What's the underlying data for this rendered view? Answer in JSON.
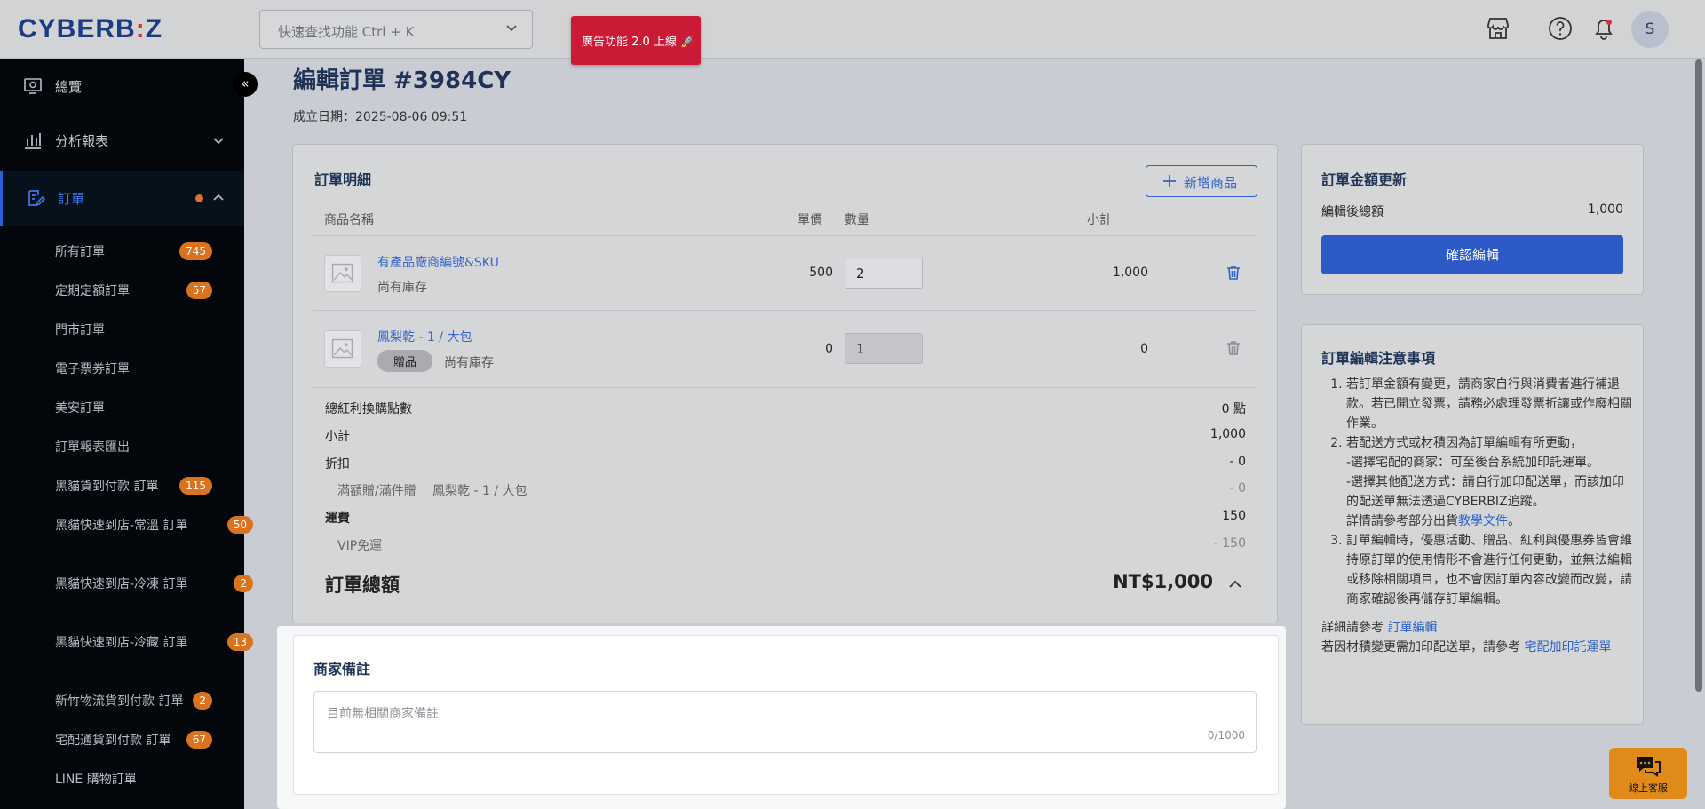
{
  "header": {
    "logo": "CYBERB",
    "logo_dot": ":",
    "logo_end": "Z",
    "search_placeholder": "快速查找功能 Ctrl + K",
    "promo": "廣告功能 2.0 上線 🚀",
    "avatar_initial": "S"
  },
  "sidebar": {
    "overview": "總覽",
    "reports": "分析報表",
    "orders": "訂單",
    "sub_items": [
      {
        "label": "所有訂單",
        "badge": "745"
      },
      {
        "label": "定期定額訂單",
        "badge": "57"
      },
      {
        "label": "門市訂單",
        "badge": ""
      },
      {
        "label": "電子票券訂單",
        "badge": ""
      },
      {
        "label": "美安訂單",
        "badge": ""
      },
      {
        "label": "訂單報表匯出",
        "badge": ""
      },
      {
        "label": "黑貓貨到付款 訂單",
        "badge": "115"
      },
      {
        "label": "黑貓快速到店-常溫 訂單",
        "badge": "50"
      },
      {
        "label": "黑貓快速到店-冷凍 訂單",
        "badge": "2"
      },
      {
        "label": "黑貓快速到店-冷藏 訂單",
        "badge": "13"
      },
      {
        "label": "新竹物流貨到付款 訂單",
        "badge": "2"
      },
      {
        "label": "宅配通貨到付款 訂單",
        "badge": "67"
      },
      {
        "label": "LINE 購物訂單",
        "badge": ""
      }
    ]
  },
  "page": {
    "title": "編輯訂單 #3984CY",
    "created": "成立日期：2025-08-06 09:51"
  },
  "order_detail": {
    "title": "訂單明細",
    "add_button": "新增商品",
    "columns": {
      "name": "商品名稱",
      "price": "單價",
      "qty": "數量",
      "subtotal": "小計"
    },
    "items": [
      {
        "name": "有產品廠商編號&SKU",
        "tag": "",
        "stock": "尚有庫存",
        "price": "500",
        "qty": "2",
        "subtotal": "1,000"
      },
      {
        "name": "鳳梨乾 - 1 / 大包",
        "tag": "贈品",
        "stock": "尚有庫存",
        "price": "0",
        "qty": "1",
        "subtotal": "0"
      }
    ],
    "summary": {
      "points_label": "總紅利換購點數",
      "points_value": "0 點",
      "subtotal_label": "小計",
      "subtotal_value": "1,000",
      "discount_label": "折扣",
      "discount_value": "- 0",
      "discount_sub_label": "滿額贈/滿件贈",
      "discount_sub_item": "鳳梨乾 - 1 / 大包",
      "discount_sub_value": "- 0",
      "shipping_label": "運費",
      "shipping_value": "150",
      "shipping_sub_label": "VIP免運",
      "shipping_sub_value": "- 150",
      "total_label": "訂單總額",
      "total_value": "NT$1,000"
    }
  },
  "merchant_note": {
    "title": "商家備註",
    "placeholder": "目前無相關商家備註",
    "counter": "0/1000"
  },
  "amount_update": {
    "title": "訂單金額更新",
    "label": "編輯後總額",
    "value": "1,000",
    "confirm": "確認編輯"
  },
  "edit_notes": {
    "title": "訂單編輯注意事項",
    "item1": "若訂單金額有變更，請商家自行與消費者進行補退款。若已開立發票，請務必處理發票折讓或作廢相關作業。",
    "item2_a": "若配送方式或材積因為訂單編輯有所更動，",
    "item2_b": "-選擇宅配的商家：可至後台系統加印託運單。",
    "item2_c": "-選擇其他配送方式：請自行加印配送單，而該加印的配送單無法透過CYBERBIZ追蹤。",
    "item2_d": "詳情請參考部分出貨",
    "item2_link": "教學文件",
    "item2_end": "。",
    "item3": "訂單編輯時，優惠活動、贈品、紅利與優惠券皆會維持原訂單的使用情形不會進行任何更動，並無法編輯或移除相關項目，也不會因訂單內容改變而改變，請商家確認後再儲存訂單編輯。",
    "ref1": "詳細請參考 ",
    "ref1_link": "訂單編輯",
    "ref2": "若因材積變更需加印配送單，請參考 ",
    "ref2_link": "宅配加印託運單"
  },
  "chat": {
    "label": "線上客服"
  }
}
